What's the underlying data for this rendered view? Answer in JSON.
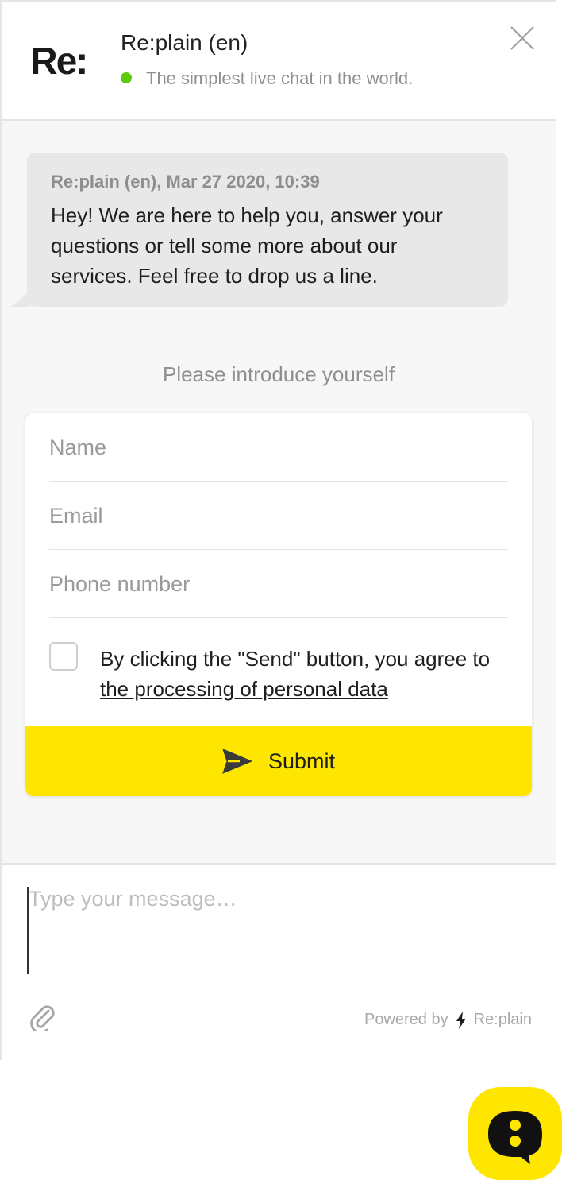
{
  "header": {
    "logo_text": "Re:",
    "title": "Re:plain (en)",
    "subtitle": "The simplest live chat in the world.",
    "status_color": "#5fc90e"
  },
  "message": {
    "meta": "Re:plain (en), Mar 27 2020, 10:39",
    "text": "Hey! We are here to help you, answer your questions or tell some more about our services. Feel free to drop us a line."
  },
  "form": {
    "intro": "Please introduce yourself",
    "name_placeholder": "Name",
    "email_placeholder": "Email",
    "phone_placeholder": "Phone number",
    "consent_prefix": "By clicking the \"Send\" button, you agree to ",
    "consent_link": "the processing of personal data",
    "submit_label": "Submit",
    "submit_color": "#ffe600"
  },
  "composer": {
    "placeholder": "Type your message…",
    "powered_by": "Powered by",
    "brand": "Re:plain"
  },
  "icons": {
    "close": "close-icon",
    "send": "send-icon",
    "attach": "paperclip-icon",
    "bolt": "bolt-icon",
    "launcher": "chat-launcher-icon"
  }
}
